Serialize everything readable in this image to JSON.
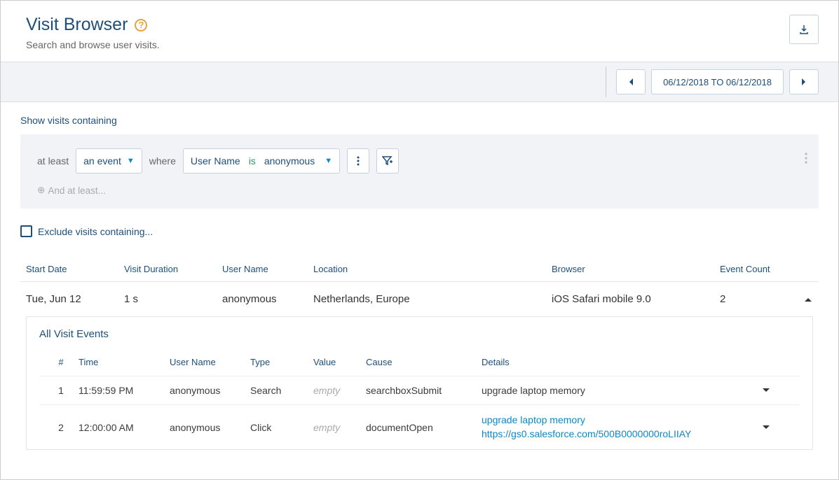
{
  "header": {
    "title": "Visit Browser",
    "subtitle": "Search and browse user visits."
  },
  "toolbar": {
    "date_range": "06/12/2018 TO 06/12/2018"
  },
  "filter": {
    "show_label": "Show visits containing",
    "at_least": "at least",
    "event_dd": "an event",
    "where_label": "where",
    "where_field": "User Name",
    "where_op": "is",
    "where_value": "anonymous",
    "add_label": "And at least...",
    "exclude_label": "Exclude visits containing..."
  },
  "columns": {
    "c0": "Start Date",
    "c1": "Visit Duration",
    "c2": "User Name",
    "c3": "Location",
    "c4": "Browser",
    "c5": "Event Count"
  },
  "row": {
    "start_date": "Tue, Jun 12",
    "duration": "1 s",
    "user": "anonymous",
    "location": "Netherlands, Europe",
    "browser": "iOS Safari mobile 9.0",
    "event_count": "2"
  },
  "events": {
    "title": "All Visit Events",
    "cols": {
      "num": "#",
      "time": "Time",
      "user": "User Name",
      "type": "Type",
      "value": "Value",
      "cause": "Cause",
      "details": "Details"
    },
    "r1": {
      "num": "1",
      "time": "11:59:59 PM",
      "user": "anonymous",
      "type": "Search",
      "value": "empty",
      "cause": "searchboxSubmit",
      "details": "upgrade laptop memory"
    },
    "r2": {
      "num": "2",
      "time": "12:00:00 AM",
      "user": "anonymous",
      "type": "Click",
      "value": "empty",
      "cause": "documentOpen",
      "details_line1": "upgrade laptop memory",
      "details_line2": "https://gs0.salesforce.com/500B0000000roLIIAY"
    }
  }
}
